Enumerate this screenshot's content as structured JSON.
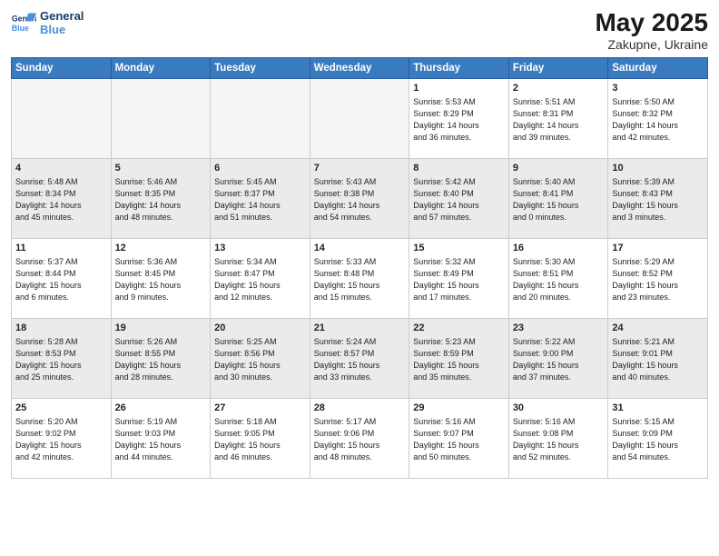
{
  "header": {
    "logo_line1": "General",
    "logo_line2": "Blue",
    "month": "May 2025",
    "location": "Zakupne, Ukraine"
  },
  "days_of_week": [
    "Sunday",
    "Monday",
    "Tuesday",
    "Wednesday",
    "Thursday",
    "Friday",
    "Saturday"
  ],
  "weeks": [
    [
      {
        "day": "",
        "info": ""
      },
      {
        "day": "",
        "info": ""
      },
      {
        "day": "",
        "info": ""
      },
      {
        "day": "",
        "info": ""
      },
      {
        "day": "1",
        "info": "Sunrise: 5:53 AM\nSunset: 8:29 PM\nDaylight: 14 hours\nand 36 minutes."
      },
      {
        "day": "2",
        "info": "Sunrise: 5:51 AM\nSunset: 8:31 PM\nDaylight: 14 hours\nand 39 minutes."
      },
      {
        "day": "3",
        "info": "Sunrise: 5:50 AM\nSunset: 8:32 PM\nDaylight: 14 hours\nand 42 minutes."
      }
    ],
    [
      {
        "day": "4",
        "info": "Sunrise: 5:48 AM\nSunset: 8:34 PM\nDaylight: 14 hours\nand 45 minutes."
      },
      {
        "day": "5",
        "info": "Sunrise: 5:46 AM\nSunset: 8:35 PM\nDaylight: 14 hours\nand 48 minutes."
      },
      {
        "day": "6",
        "info": "Sunrise: 5:45 AM\nSunset: 8:37 PM\nDaylight: 14 hours\nand 51 minutes."
      },
      {
        "day": "7",
        "info": "Sunrise: 5:43 AM\nSunset: 8:38 PM\nDaylight: 14 hours\nand 54 minutes."
      },
      {
        "day": "8",
        "info": "Sunrise: 5:42 AM\nSunset: 8:40 PM\nDaylight: 14 hours\nand 57 minutes."
      },
      {
        "day": "9",
        "info": "Sunrise: 5:40 AM\nSunset: 8:41 PM\nDaylight: 15 hours\nand 0 minutes."
      },
      {
        "day": "10",
        "info": "Sunrise: 5:39 AM\nSunset: 8:43 PM\nDaylight: 15 hours\nand 3 minutes."
      }
    ],
    [
      {
        "day": "11",
        "info": "Sunrise: 5:37 AM\nSunset: 8:44 PM\nDaylight: 15 hours\nand 6 minutes."
      },
      {
        "day": "12",
        "info": "Sunrise: 5:36 AM\nSunset: 8:45 PM\nDaylight: 15 hours\nand 9 minutes."
      },
      {
        "day": "13",
        "info": "Sunrise: 5:34 AM\nSunset: 8:47 PM\nDaylight: 15 hours\nand 12 minutes."
      },
      {
        "day": "14",
        "info": "Sunrise: 5:33 AM\nSunset: 8:48 PM\nDaylight: 15 hours\nand 15 minutes."
      },
      {
        "day": "15",
        "info": "Sunrise: 5:32 AM\nSunset: 8:49 PM\nDaylight: 15 hours\nand 17 minutes."
      },
      {
        "day": "16",
        "info": "Sunrise: 5:30 AM\nSunset: 8:51 PM\nDaylight: 15 hours\nand 20 minutes."
      },
      {
        "day": "17",
        "info": "Sunrise: 5:29 AM\nSunset: 8:52 PM\nDaylight: 15 hours\nand 23 minutes."
      }
    ],
    [
      {
        "day": "18",
        "info": "Sunrise: 5:28 AM\nSunset: 8:53 PM\nDaylight: 15 hours\nand 25 minutes."
      },
      {
        "day": "19",
        "info": "Sunrise: 5:26 AM\nSunset: 8:55 PM\nDaylight: 15 hours\nand 28 minutes."
      },
      {
        "day": "20",
        "info": "Sunrise: 5:25 AM\nSunset: 8:56 PM\nDaylight: 15 hours\nand 30 minutes."
      },
      {
        "day": "21",
        "info": "Sunrise: 5:24 AM\nSunset: 8:57 PM\nDaylight: 15 hours\nand 33 minutes."
      },
      {
        "day": "22",
        "info": "Sunrise: 5:23 AM\nSunset: 8:59 PM\nDaylight: 15 hours\nand 35 minutes."
      },
      {
        "day": "23",
        "info": "Sunrise: 5:22 AM\nSunset: 9:00 PM\nDaylight: 15 hours\nand 37 minutes."
      },
      {
        "day": "24",
        "info": "Sunrise: 5:21 AM\nSunset: 9:01 PM\nDaylight: 15 hours\nand 40 minutes."
      }
    ],
    [
      {
        "day": "25",
        "info": "Sunrise: 5:20 AM\nSunset: 9:02 PM\nDaylight: 15 hours\nand 42 minutes."
      },
      {
        "day": "26",
        "info": "Sunrise: 5:19 AM\nSunset: 9:03 PM\nDaylight: 15 hours\nand 44 minutes."
      },
      {
        "day": "27",
        "info": "Sunrise: 5:18 AM\nSunset: 9:05 PM\nDaylight: 15 hours\nand 46 minutes."
      },
      {
        "day": "28",
        "info": "Sunrise: 5:17 AM\nSunset: 9:06 PM\nDaylight: 15 hours\nand 48 minutes."
      },
      {
        "day": "29",
        "info": "Sunrise: 5:16 AM\nSunset: 9:07 PM\nDaylight: 15 hours\nand 50 minutes."
      },
      {
        "day": "30",
        "info": "Sunrise: 5:16 AM\nSunset: 9:08 PM\nDaylight: 15 hours\nand 52 minutes."
      },
      {
        "day": "31",
        "info": "Sunrise: 5:15 AM\nSunset: 9:09 PM\nDaylight: 15 hours\nand 54 minutes."
      }
    ]
  ]
}
